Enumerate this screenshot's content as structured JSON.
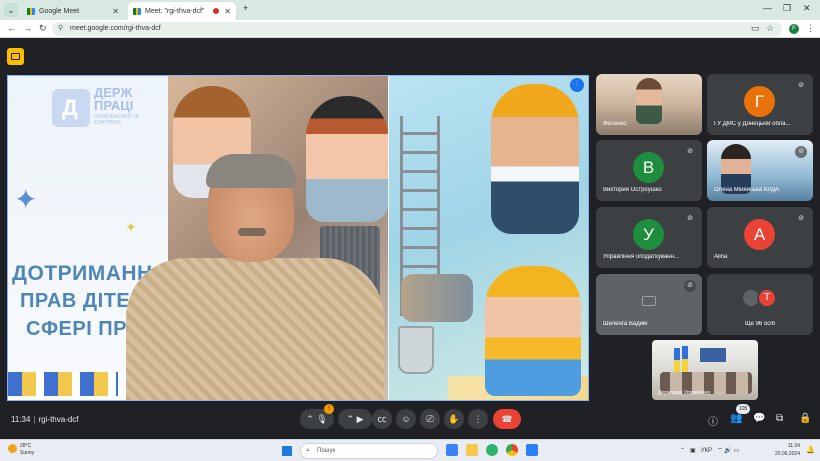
{
  "browser": {
    "tabs": [
      {
        "label": "Google Meet",
        "active": false
      },
      {
        "label": "Meet: \"rgi-thva-dcf\"",
        "active": true
      }
    ],
    "new_tab_glyph": "+",
    "url": "meet.google.com/rgi-thva-dcf",
    "profile_initial": "F"
  },
  "meeting": {
    "time": "11:34",
    "code": "rgi-thva-dcf",
    "mic_badge": "!",
    "people_count": "105",
    "main_video": {
      "org_logo_title": "ДЕРЖ ПРАЦІ",
      "org_logo_subtitle": "ПОМЕДЖЕННЯ ТА КОНТРОЛЬ",
      "slide_lines": [
        "ДОТРИМАННЯ",
        "ПРАВ ДІТЕЙ У",
        "СФЕРІ ПРА"
      ]
    },
    "participants": [
      {
        "name": "Фесенко",
        "type": "video",
        "muted": false
      },
      {
        "name": "ГУ ДМС у Донецькій обла...",
        "initial": "Г",
        "color": "#e8710a",
        "muted": true
      },
      {
        "name": "Виктория Остроушко",
        "initial": "В",
        "color": "#1e8e3e",
        "muted": true
      },
      {
        "name": "Олена Міняйська КРДА",
        "type": "video",
        "muted": true
      },
      {
        "name": "Управління оподаткуванн...",
        "initial": "У",
        "color": "#1e8e3e",
        "muted": true
      },
      {
        "name": "Alina",
        "initial": "А",
        "color": "#ea4335",
        "muted": true
      },
      {
        "name": "Шеленга Вадим",
        "type": "camera-off",
        "muted": true
      },
      {
        "name": "Ще 96 осіб",
        "type": "more",
        "initials": [
          "",
          "Т"
        ]
      }
    ],
    "self_view_label": "Держпраці Управління"
  },
  "taskbar": {
    "weather_temp": "28°C",
    "weather_text": "Sunny",
    "search_placeholder": "Пошук",
    "language": "УКР",
    "clock_time": "11:34",
    "clock_date": "20.06.2024"
  },
  "colors": {
    "meet_bg": "#202124",
    "tile_bg": "#3c4043",
    "hangup": "#ea4335",
    "accent": "#8ab4f8"
  }
}
